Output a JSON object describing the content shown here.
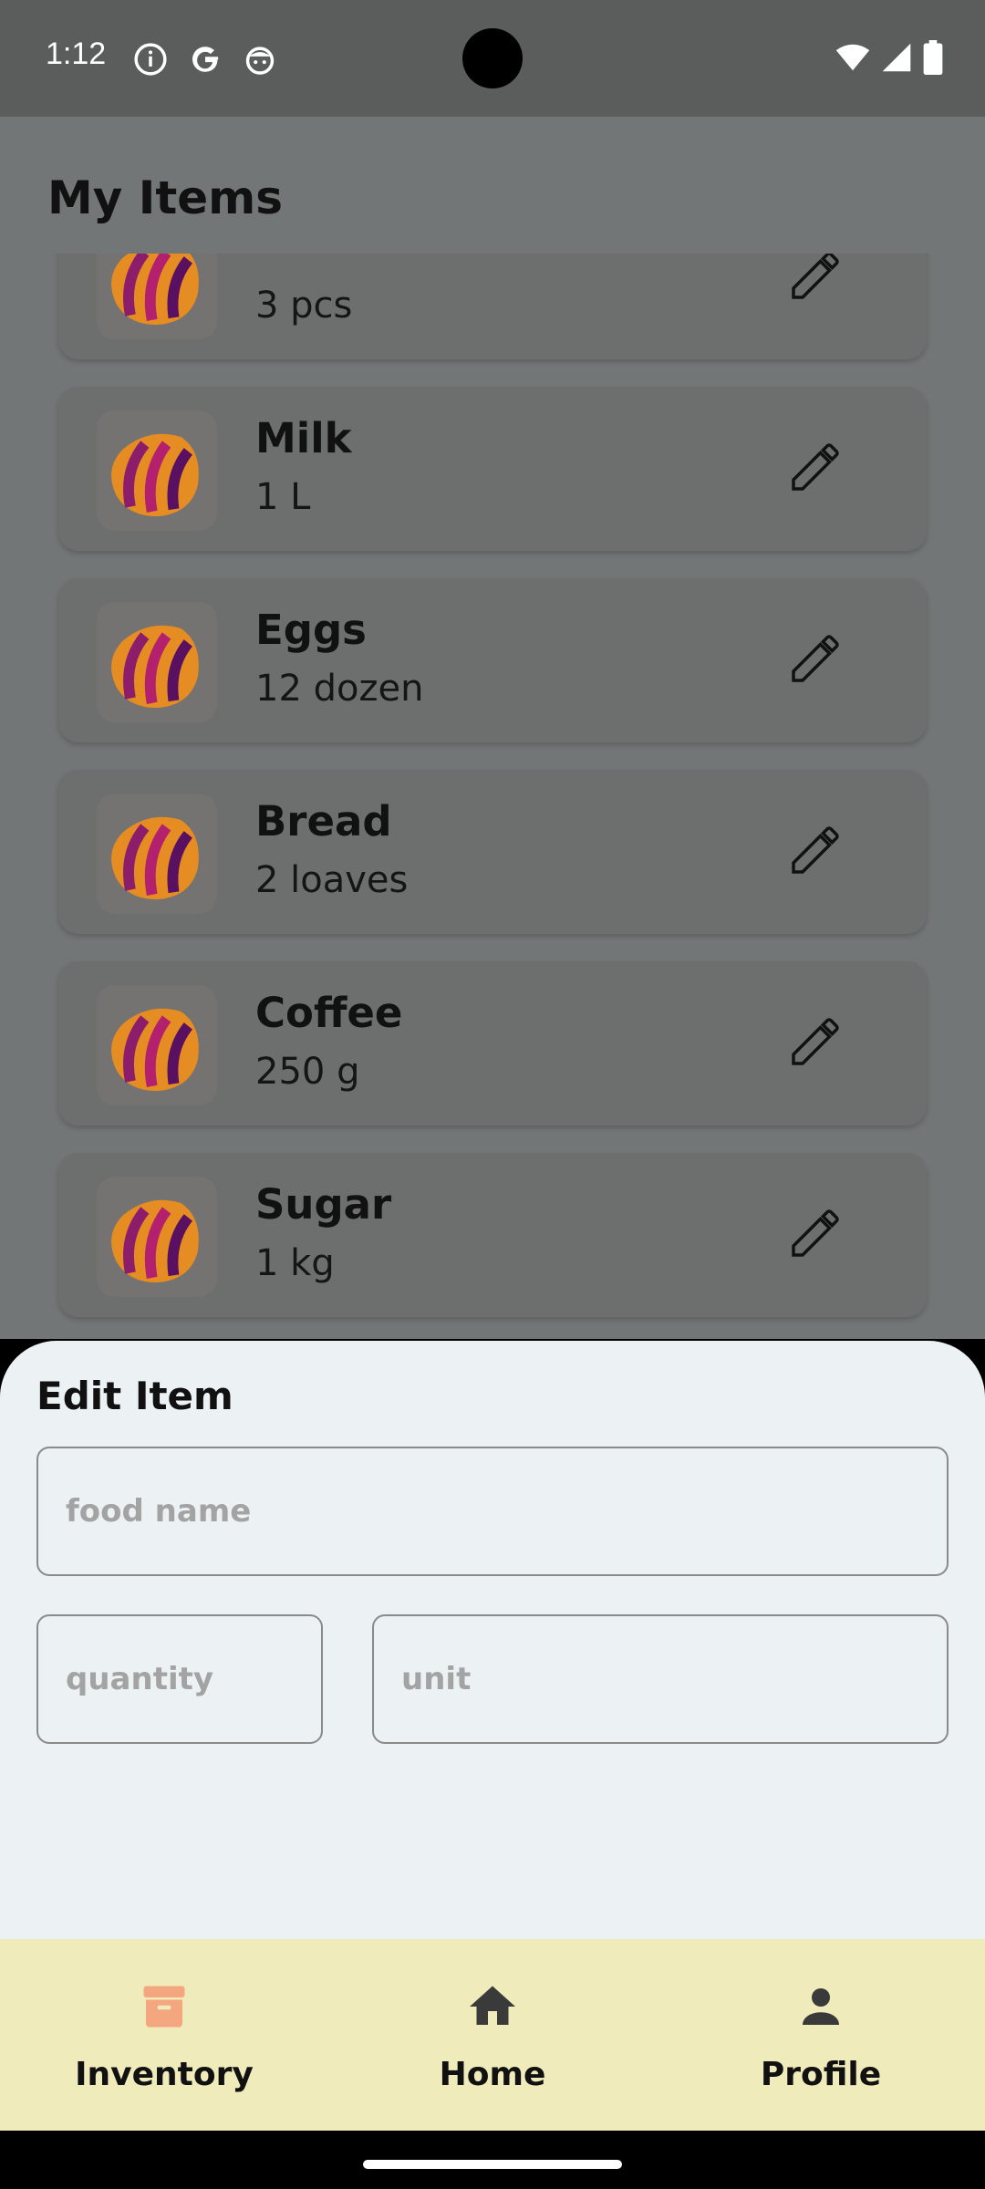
{
  "status_bar": {
    "time": "1:12",
    "left_icons": [
      "info-icon",
      "google-icon",
      "android-face-icon"
    ],
    "right_icons": [
      "wifi-icon",
      "signal-icon",
      "battery-icon"
    ]
  },
  "page": {
    "title": "My Items"
  },
  "items": [
    {
      "name": "",
      "quantity": "3 pcs"
    },
    {
      "name": "Milk",
      "quantity": "1 L"
    },
    {
      "name": "Eggs",
      "quantity": "12 dozen"
    },
    {
      "name": "Bread",
      "quantity": "2 loaves"
    },
    {
      "name": "Coffee",
      "quantity": "250 g"
    },
    {
      "name": "Sugar",
      "quantity": "1 kg"
    }
  ],
  "edit_sheet": {
    "title": "Edit Item",
    "name_placeholder": "food name",
    "quantity_placeholder": "quantity",
    "unit_placeholder": "unit"
  },
  "nav": {
    "items": [
      {
        "label": "Inventory",
        "icon": "archive-box-icon",
        "active": true
      },
      {
        "label": "Home",
        "icon": "home-icon",
        "active": false
      },
      {
        "label": "Profile",
        "icon": "person-icon",
        "active": false
      }
    ]
  },
  "colors": {
    "nav_background": "#efebbb",
    "nav_active_icon": "#f4a77e",
    "sheet_background": "#ecf2f3",
    "scrim_overlay": "#737676"
  }
}
